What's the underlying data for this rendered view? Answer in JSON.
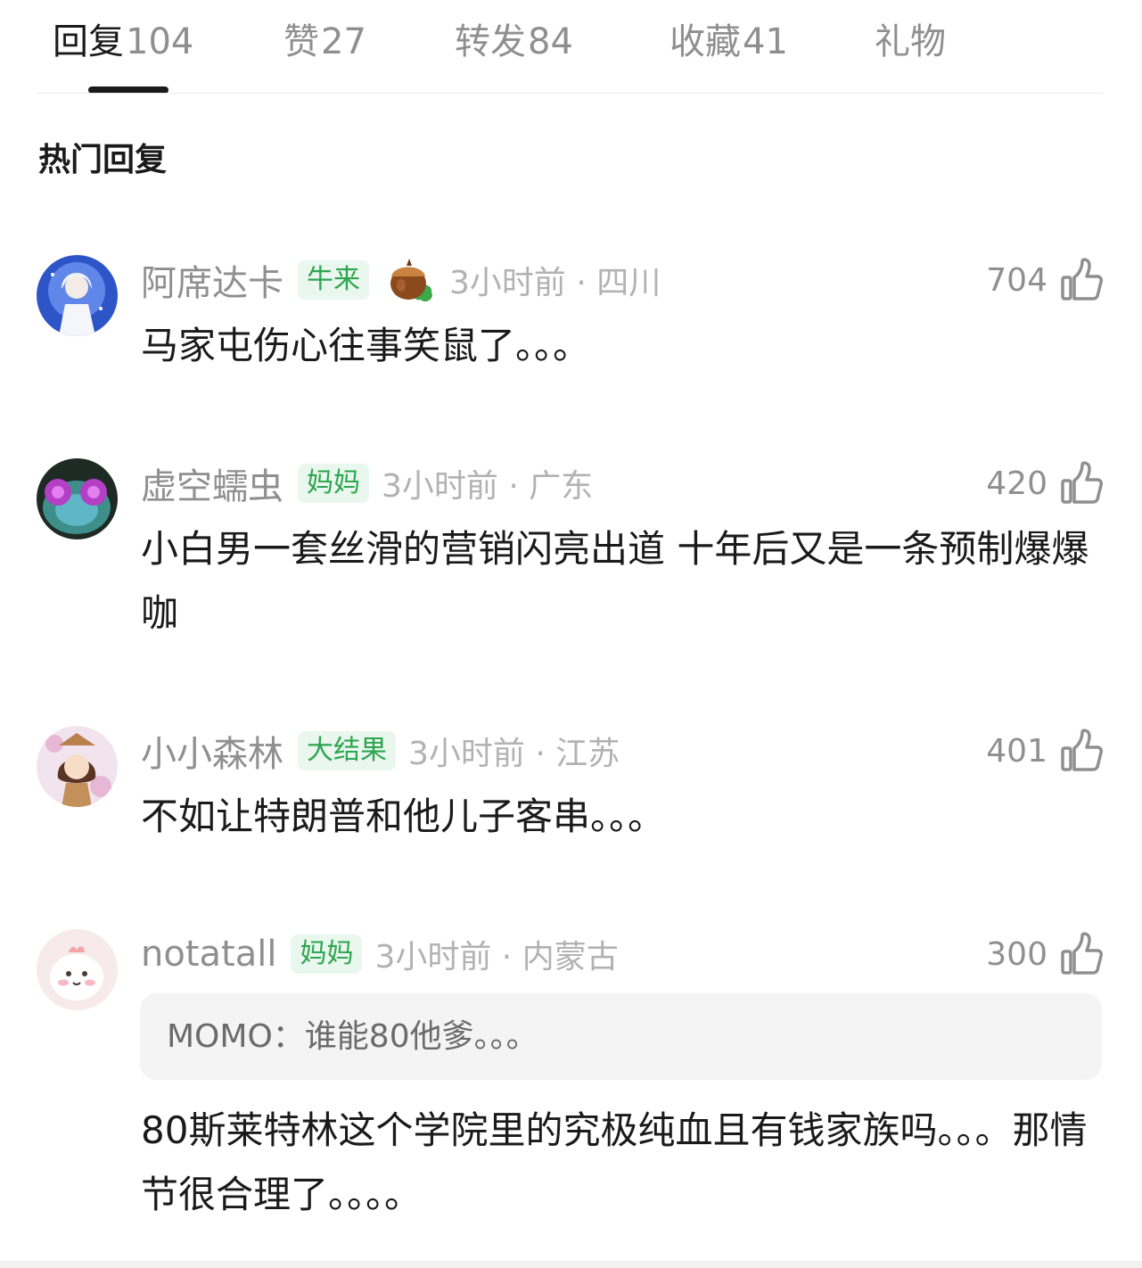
{
  "tabs": [
    {
      "label": "回复",
      "count": "104",
      "active": true
    },
    {
      "label": "赞",
      "count": "27",
      "active": false
    },
    {
      "label": "转发",
      "count": "84",
      "active": false
    },
    {
      "label": "收藏",
      "count": "41",
      "active": false
    },
    {
      "label": "礼物",
      "count": "",
      "active": false
    }
  ],
  "section_title": "热门回复",
  "comments": [
    {
      "user": "阿席达卡",
      "badge": "牛来",
      "medal_icon": "hazelnut-medal-icon",
      "time": "3小时前 · 四川",
      "likes": "704",
      "text": "马家屯伤心往事笑鼠了。。。"
    },
    {
      "user": "虚空蠕虫",
      "badge": "妈妈",
      "time": "3小时前 · 广东",
      "likes": "420",
      "text": "小白男一套丝滑的营销闪亮出道 十年后又是一条预制爆爆咖"
    },
    {
      "user": "小小森林",
      "badge": "大结果",
      "time": "3小时前 · 江苏",
      "likes": "401",
      "text": "不如让特朗普和他儿子客串。。。"
    },
    {
      "user": "notatall",
      "badge": "妈妈",
      "time": "3小时前 · 内蒙古",
      "likes": "300",
      "quote": "MOMO：谁能80他爹。。。",
      "text": "80斯莱特林这个学院里的究极纯血且有钱家族吗。。。那情节很合理了。。。。"
    }
  ],
  "colors": {
    "badge_green": "#2ca650",
    "badge_bg": "#eaf7ee",
    "muted": "#8f8f8f",
    "text": "#1a1a1a"
  }
}
